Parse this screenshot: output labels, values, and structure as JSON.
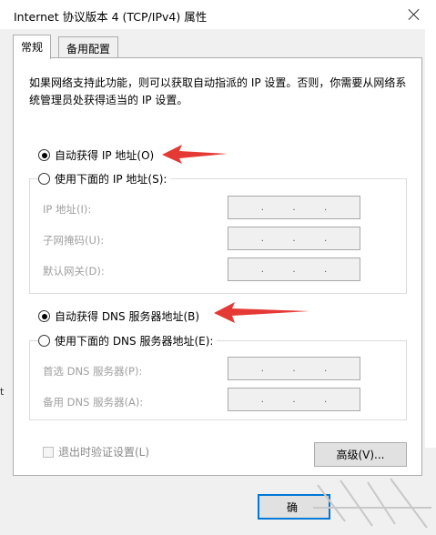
{
  "window": {
    "title": "Internet 协议版本 4 (TCP/IPv4) 属性"
  },
  "tabs": [
    {
      "label": "常规"
    },
    {
      "label": "备用配置"
    }
  ],
  "description": "如果网络支持此功能，则可以获取自动指派的 IP 设置。否则，你需要从网络系统管理员处获得适当的 IP 设置。",
  "ip_section": {
    "auto_label": "自动获得 IP 地址(O)",
    "manual_label": "使用下面的 IP 地址(S):",
    "auto_selected": true,
    "fields": [
      {
        "label": "IP 地址(I):"
      },
      {
        "label": "子网掩码(U):"
      },
      {
        "label": "默认网关(D):"
      }
    ]
  },
  "dns_section": {
    "auto_label": "自动获得 DNS 服务器地址(B)",
    "manual_label": "使用下面的 DNS 服务器地址(E):",
    "auto_selected": true,
    "fields": [
      {
        "label": "首选 DNS 服务器(P):"
      },
      {
        "label": "备用 DNS 服务器(A):"
      }
    ]
  },
  "footer": {
    "validate_label": "退出时验证设置(L)",
    "advanced_label": "高级(V)...",
    "ok_label": "确",
    "left_edge_glyph": "t"
  },
  "colors": {
    "arrow": "#e53935",
    "focus_border": "#0078d7",
    "disabled_text": "#a0a0a0"
  }
}
